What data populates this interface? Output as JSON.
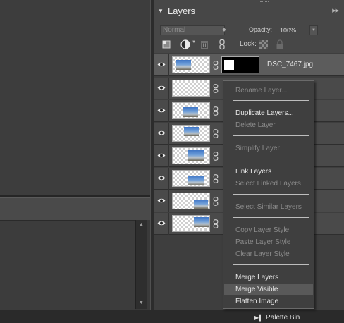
{
  "layers_panel": {
    "title": "Layers",
    "blend_mode": "Normal",
    "opacity_label": "Opacity:",
    "opacity_value": "100%",
    "lock_label": "Lock:"
  },
  "layers": [
    {
      "name": "DSC_7467.jpg",
      "has_mask": true
    },
    {
      "name": "",
      "has_mask": false
    },
    {
      "name": "",
      "has_mask": false
    },
    {
      "name": "",
      "has_mask": false
    },
    {
      "name": "",
      "has_mask": false
    },
    {
      "name": "",
      "has_mask": false
    },
    {
      "name": "",
      "has_mask": false
    },
    {
      "name": "",
      "has_mask": false
    }
  ],
  "context_menu": {
    "items": [
      {
        "label": "Rename Layer...",
        "enabled": false
      },
      {
        "label": "Duplicate Layers...",
        "enabled": true
      },
      {
        "label": "Delete Layer",
        "enabled": false
      },
      {
        "label": "Simplify Layer",
        "enabled": false
      },
      {
        "label": "Link Layers",
        "enabled": true
      },
      {
        "label": "Select Linked Layers",
        "enabled": false
      },
      {
        "label": "Select Similar Layers",
        "enabled": false
      },
      {
        "label": "Copy Layer Style",
        "enabled": false
      },
      {
        "label": "Paste Layer Style",
        "enabled": false
      },
      {
        "label": "Clear Layer Style",
        "enabled": false
      },
      {
        "label": "Merge Layers",
        "enabled": true
      },
      {
        "label": "Merge Visible",
        "enabled": true,
        "highlighted": true
      },
      {
        "label": "Flatten Image",
        "enabled": true
      }
    ]
  },
  "status_bar": {
    "palette_bin_label": "Palette Bin"
  },
  "colors": {
    "panel_bg": "#474747",
    "menu_bg": "#3f3f3f",
    "menu_highlight": "#595959",
    "sky_blue": "#3f76c6"
  }
}
